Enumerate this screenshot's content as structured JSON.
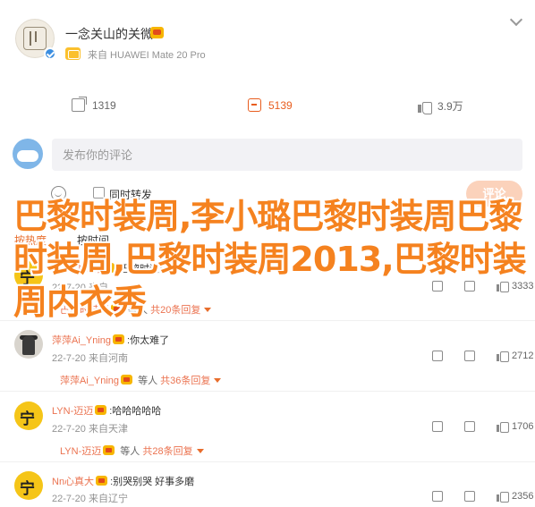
{
  "post": {
    "username": "一念关山的关微",
    "device": "来自 HUAWEI Mate 20 Pro",
    "shares": "1319",
    "comments": "5139",
    "likes": "3.9万"
  },
  "composer": {
    "placeholder": "发布你的评论",
    "repost_label": "同时转发",
    "send_label": "评论"
  },
  "sort": {
    "active": "按热度",
    "other": "按时间"
  },
  "comments": [
    {
      "name": "巴黎时装周",
      "text": ":巴黎时装周",
      "time": "22-7-20 来自",
      "reply_name": "巴黎时装周",
      "reply_suffix": " 等人",
      "reply_count": "共20条回复",
      "likes": "3333"
    },
    {
      "name": "萍萍Ai_Yning",
      "text": ":你太难了",
      "time": "22-7-20 来自河南",
      "reply_name": "萍萍Ai_Yning",
      "reply_suffix": " 等人",
      "reply_count": "共36条回复",
      "likes": "2712"
    },
    {
      "name": "LYN-迈迈",
      "text": ":哈哈哈哈哈",
      "time": "22-7-20 来自天津",
      "reply_name": "LYN-迈迈",
      "reply_suffix": " 等人",
      "reply_count": "共28条回复",
      "likes": "1706"
    },
    {
      "name": "Nn心真大",
      "text": ":别哭别哭 好事多磨",
      "time": "22-7-20 来自辽宁",
      "likes": "2356"
    }
  ],
  "overlay": {
    "line": "巴黎时装周,李小璐巴黎时装周巴黎时装周,巴黎时装周2013,巴黎时装周内衣秀"
  }
}
